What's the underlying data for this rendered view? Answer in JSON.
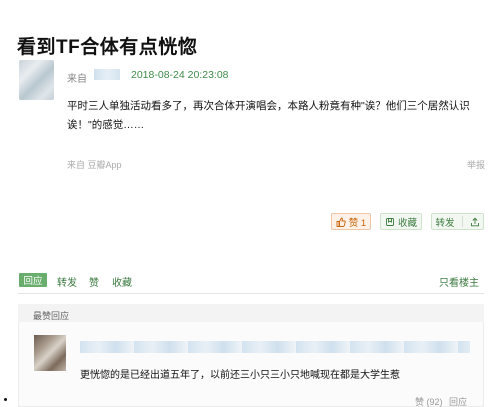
{
  "post": {
    "title": "看到TF合体有点恍惚",
    "from_label": "来自",
    "time": "2018-08-24 20:23:08",
    "body": "平时三人单独活动看多了，再次合体开演唱会，本路人粉竟有种\"诶？他们三个居然认识诶！\"的感觉……",
    "source": "来自 豆瓣App",
    "report": "举报"
  },
  "buttons": {
    "like_label": "赞 1",
    "fav_label": "收藏",
    "share_label": "转发"
  },
  "actions": {
    "reply": "回应",
    "forward": "转发",
    "like": "赞",
    "favorite": "收藏",
    "only_op": "只看楼主"
  },
  "best_replies": {
    "header": "最赞回应",
    "comment_text": "更恍惚的是已经出道五年了，以前还三小只三小只地喊现在都是大学生惹",
    "like_count": "赞 (92)",
    "reply_label": "回应"
  },
  "colors": {
    "accent_green": "#3b7a3f",
    "time_green": "#3f8a49",
    "like_orange": "#c8650a",
    "reply_button_bg": "#6aae6d"
  },
  "icons": {
    "like": "thumbs-up-icon",
    "fav": "bookmark-icon",
    "share": "share-icon"
  }
}
